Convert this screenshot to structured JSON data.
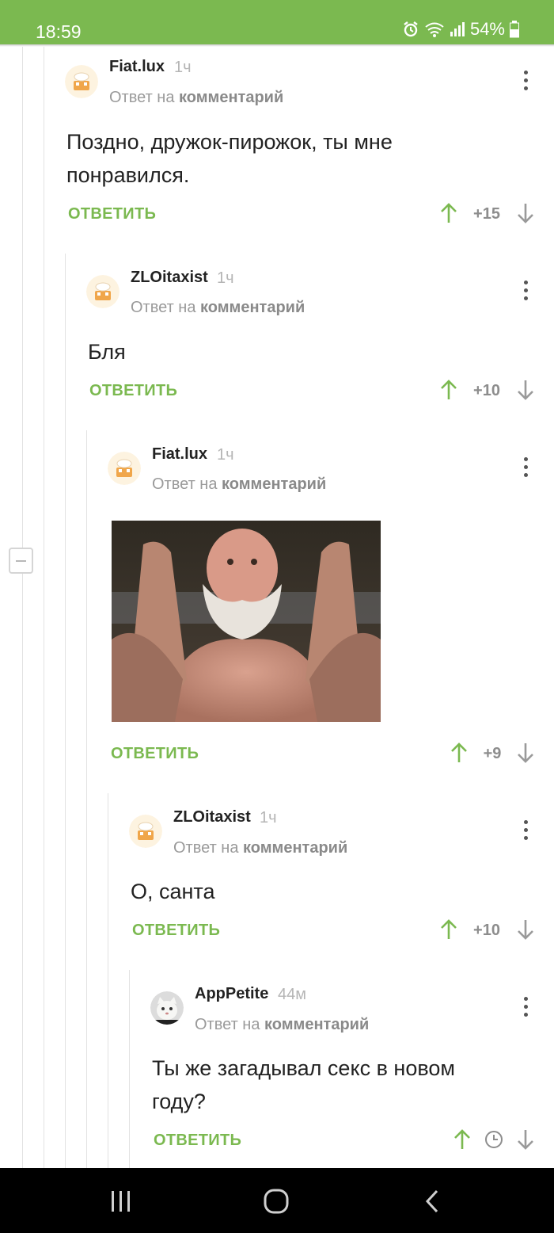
{
  "status_bar": {
    "time": "18:59",
    "battery": "54%"
  },
  "comments": [
    {
      "author": "Fiat.lux",
      "time": "1ч",
      "reply_prefix": "Ответ на",
      "reply_target": "комментарий",
      "text": "Поздно, дружок-пирожок, ты мне понравился.",
      "reply_label": "ОТВЕТИТЬ",
      "rating": "+15"
    },
    {
      "author": "ZLOitaxist",
      "time": "1ч",
      "reply_prefix": "Ответ на",
      "reply_target": "комментарий",
      "text": "Бля",
      "reply_label": "ОТВЕТИТЬ",
      "rating": "+10"
    },
    {
      "author": "Fiat.lux",
      "time": "1ч",
      "reply_prefix": "Ответ на",
      "reply_target": "комментарий",
      "text": "",
      "reply_label": "ОТВЕТИТЬ",
      "rating": "+9"
    },
    {
      "author": "ZLOitaxist",
      "time": "1ч",
      "reply_prefix": "Ответ на",
      "reply_target": "комментарий",
      "text": "О, санта",
      "reply_label": "ОТВЕТИТЬ",
      "rating": "+10"
    },
    {
      "author": "AppPetite",
      "time": "44м",
      "reply_prefix": "Ответ на",
      "reply_target": "комментарий",
      "text": "Ты же загадывал секс в новом году?",
      "reply_label": "ОТВЕТИТЬ",
      "rating": ""
    }
  ],
  "colors": {
    "accent": "#7bb950",
    "text": "#222222",
    "muted": "#9a9a9a"
  },
  "icons": [
    "alarm-icon",
    "wifi-icon",
    "signal-icon",
    "battery-icon",
    "up-arrow-icon",
    "down-arrow-icon",
    "menu-dots-icon",
    "clock-icon",
    "recents-icon",
    "home-icon",
    "back-icon"
  ]
}
